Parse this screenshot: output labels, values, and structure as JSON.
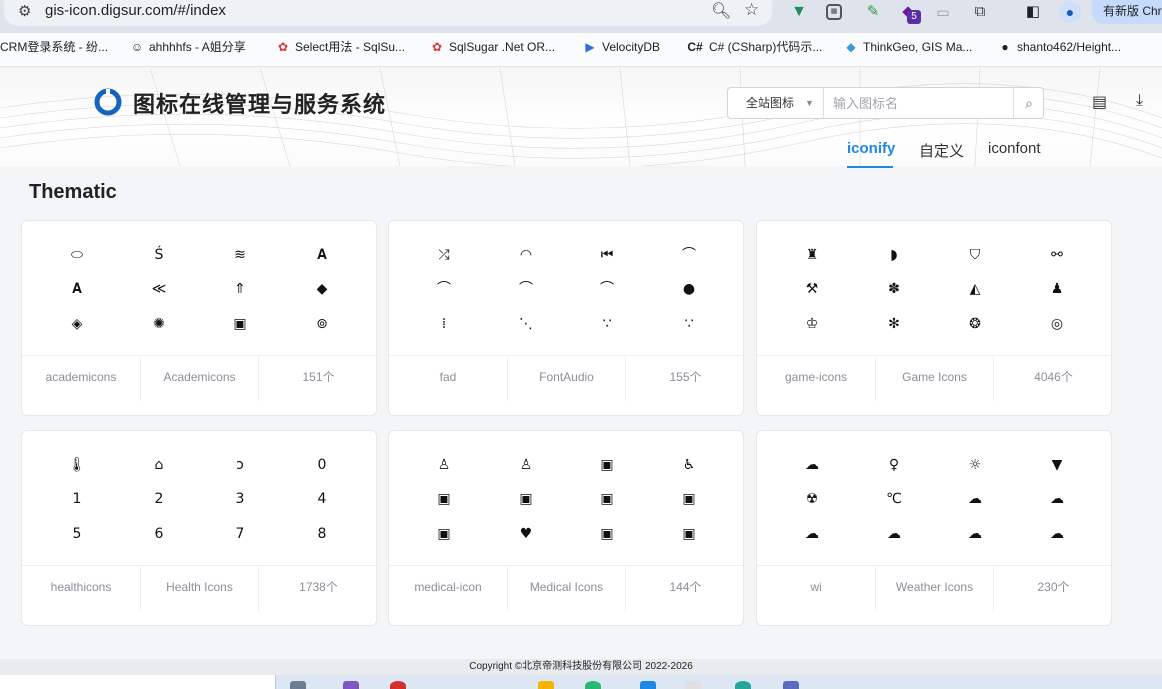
{
  "browser": {
    "url": "gis-icon.digsur.com/#/index",
    "update_button": "有新版 Chr",
    "extension_badge": "5",
    "bookmarks": [
      {
        "label": "CRM登录系统 - 纷...",
        "icon": "none"
      },
      {
        "label": "ahhhhfs - A姐分享",
        "icon": "avatar-icon"
      },
      {
        "label": "Select用法 - SqlSu...",
        "icon": "sqlsugar-icon"
      },
      {
        "label": "SqlSugar .Net OR...",
        "icon": "sqlsugar-icon"
      },
      {
        "label": "VelocityDB",
        "icon": "velocity-icon"
      },
      {
        "label": "C# (CSharp)代码示...",
        "icon": "csharp-icon"
      },
      {
        "label": "ThinkGeo, GIS Ma...",
        "icon": "thinkgeo-icon"
      },
      {
        "label": "shanto462/Height...",
        "icon": "github-icon"
      }
    ]
  },
  "header": {
    "title": "图标在线管理与服务系统",
    "search_scope": "全站图标",
    "search_placeholder": "输入图标名",
    "tabs": [
      "iconify",
      "自定义",
      "iconfont"
    ],
    "active_tab": 0
  },
  "section": {
    "title": "Thematic"
  },
  "cards": [
    {
      "prefix": "academicons",
      "name": "Academicons",
      "count": "151个",
      "glyphs": [
        "⬭",
        "Ś",
        "≋",
        "𝐀",
        "𝐀",
        "≪",
        "⇑",
        "◆",
        "◈",
        "✺",
        "▣",
        "⊚"
      ]
    },
    {
      "prefix": "fad",
      "name": "FontAudio",
      "count": "155个",
      "glyphs": [
        "⤮",
        "◠",
        "⏮",
        "⌒",
        "⌒",
        "⌒",
        "⌒",
        "●",
        "⁞",
        "⋱",
        "∵",
        "∵"
      ]
    },
    {
      "prefix": "game-icons",
      "name": "Game Icons",
      "count": "4046个",
      "glyphs": [
        "♜",
        "◗",
        "⛉",
        "⚯",
        "⚒",
        "✽",
        "◭",
        "♟",
        "♔",
        "✻",
        "❂",
        "◎"
      ]
    },
    {
      "prefix": "healthicons",
      "name": "Health Icons",
      "count": "1738个",
      "glyphs": [
        "🌡",
        "⌂",
        "ↄ",
        "0",
        "1",
        "2",
        "3",
        "4",
        "5",
        "6",
        "7",
        "8"
      ]
    },
    {
      "prefix": "medical-icon",
      "name": "Medical Icons",
      "count": "144个",
      "glyphs": [
        "♙",
        "♙",
        "▣",
        "♿",
        "▣",
        "▣",
        "▣",
        "▣",
        "▣",
        "♥",
        "▣",
        "▣"
      ]
    },
    {
      "prefix": "wi",
      "name": "Weather Icons",
      "count": "230个",
      "glyphs": [
        "☁",
        "♀",
        "☼",
        "▼",
        "☢",
        "℃",
        "☁",
        "☁",
        "☁",
        "☁",
        "☁",
        "☁"
      ]
    }
  ],
  "footer": {
    "copyright": "Copyright ©北京帝测科技股份有限公司 2022-2026"
  }
}
